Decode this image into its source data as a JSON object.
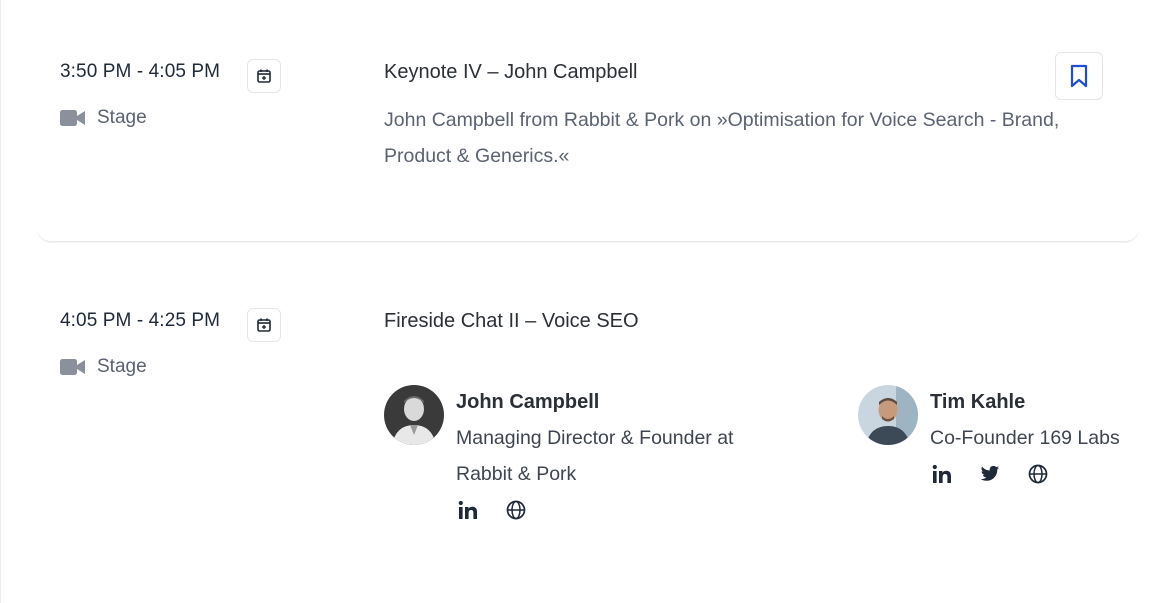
{
  "sessions": [
    {
      "time": "3:50 PM - 4:05 PM",
      "location": "Stage",
      "title": "Keynote IV – John Campbell",
      "description": "John Campbell from Rabbit & Pork on »Optimisation for Voice Search - Brand, Product & Generics.«",
      "icons": {
        "calendar": "calendar-add-icon",
        "location": "video-camera-icon",
        "bookmark": "bookmark-icon"
      }
    },
    {
      "time": "4:05 PM - 4:25 PM",
      "location": "Stage",
      "title": "Fireside Chat II – Voice SEO",
      "icons": {
        "calendar": "calendar-add-icon",
        "location": "video-camera-icon"
      },
      "speakers": [
        {
          "name": "John Campbell",
          "role": "Managing Director & Founder at Rabbit & Pork",
          "socials": [
            "linkedin-icon",
            "globe-icon"
          ]
        },
        {
          "name": "Tim Kahle",
          "role": "Co-Founder 169 Labs",
          "socials": [
            "linkedin-icon",
            "twitter-icon",
            "globe-icon"
          ]
        }
      ]
    }
  ],
  "colors": {
    "text_dark": "#2b2f36",
    "text_muted": "#5b6270",
    "icon_gray": "#8a909c",
    "accent_blue": "#1d4ed8",
    "border": "#e3e5ea"
  }
}
